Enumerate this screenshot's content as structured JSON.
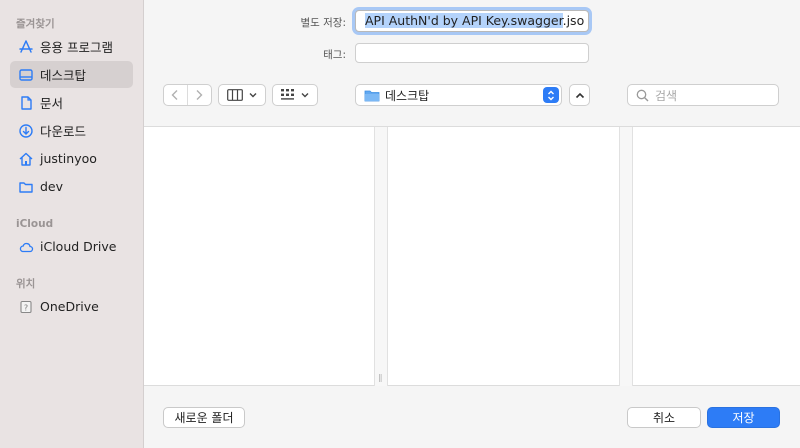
{
  "sidebar": {
    "favorites_label": "즐겨찾기",
    "items": [
      {
        "label": "응용 프로그램",
        "icon": "applications-icon"
      },
      {
        "label": "데스크탑",
        "icon": "desktop-icon",
        "selected": true
      },
      {
        "label": "문서",
        "icon": "document-icon"
      },
      {
        "label": "다운로드",
        "icon": "download-icon"
      },
      {
        "label": "justinyoo",
        "icon": "home-icon"
      },
      {
        "label": "dev",
        "icon": "folder-icon"
      }
    ],
    "icloud_label": "iCloud",
    "icloud_items": [
      {
        "label": "iCloud Drive",
        "icon": "cloud-icon"
      }
    ],
    "locations_label": "위치",
    "location_items": [
      {
        "label": "OneDrive",
        "icon": "unknown-drive-icon"
      }
    ]
  },
  "form": {
    "save_as_label": "별도 저장:",
    "filename_selected": "API AuthN'd by API Key.swagger",
    "filename_rest": ".jso",
    "tags_label": "태그:",
    "tags_value": ""
  },
  "toolbar": {
    "location": "데스크탑",
    "search_placeholder": "검색"
  },
  "footer": {
    "new_folder": "새로운 폴더",
    "cancel": "취소",
    "save": "저장"
  },
  "colors": {
    "accent": "#2d7cf6",
    "sidebar_bg": "#e9e3e3",
    "icon_blue": "#2d7cf6"
  }
}
